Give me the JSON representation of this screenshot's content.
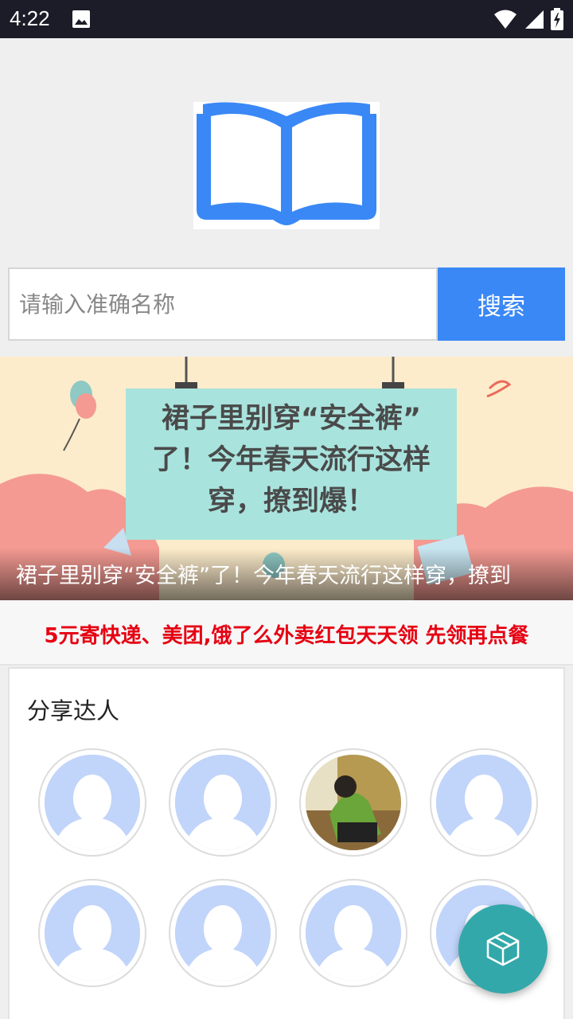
{
  "status_bar": {
    "time": "4:22",
    "icons": [
      "image-icon",
      "wifi-icon",
      "signal-icon",
      "battery-charging-icon"
    ]
  },
  "logo": {
    "icon": "open-book-icon",
    "color": "#3a88f5"
  },
  "search": {
    "placeholder": "请输入准确名称",
    "button_label": "搜索",
    "accent_color": "#3a88f5"
  },
  "banner": {
    "image_text": [
      "裙子里别穿“安全裤”",
      "了！今年春天流行这样",
      "穿，撩到爆！"
    ],
    "caption": "裙子里别穿“安全裤”了！今年春天流行这样穿，撩到"
  },
  "promo": {
    "text": "5元寄快递、美团,饿了么外卖红包天天领 先领再点餐",
    "color": "#e60012"
  },
  "share": {
    "title": "分享达人",
    "avatars": [
      {
        "type": "default"
      },
      {
        "type": "default"
      },
      {
        "type": "photo"
      },
      {
        "type": "default"
      },
      {
        "type": "default"
      },
      {
        "type": "default"
      },
      {
        "type": "default"
      },
      {
        "type": "default"
      }
    ]
  },
  "fab": {
    "icon": "cube-icon",
    "color": "#33a8aa"
  }
}
